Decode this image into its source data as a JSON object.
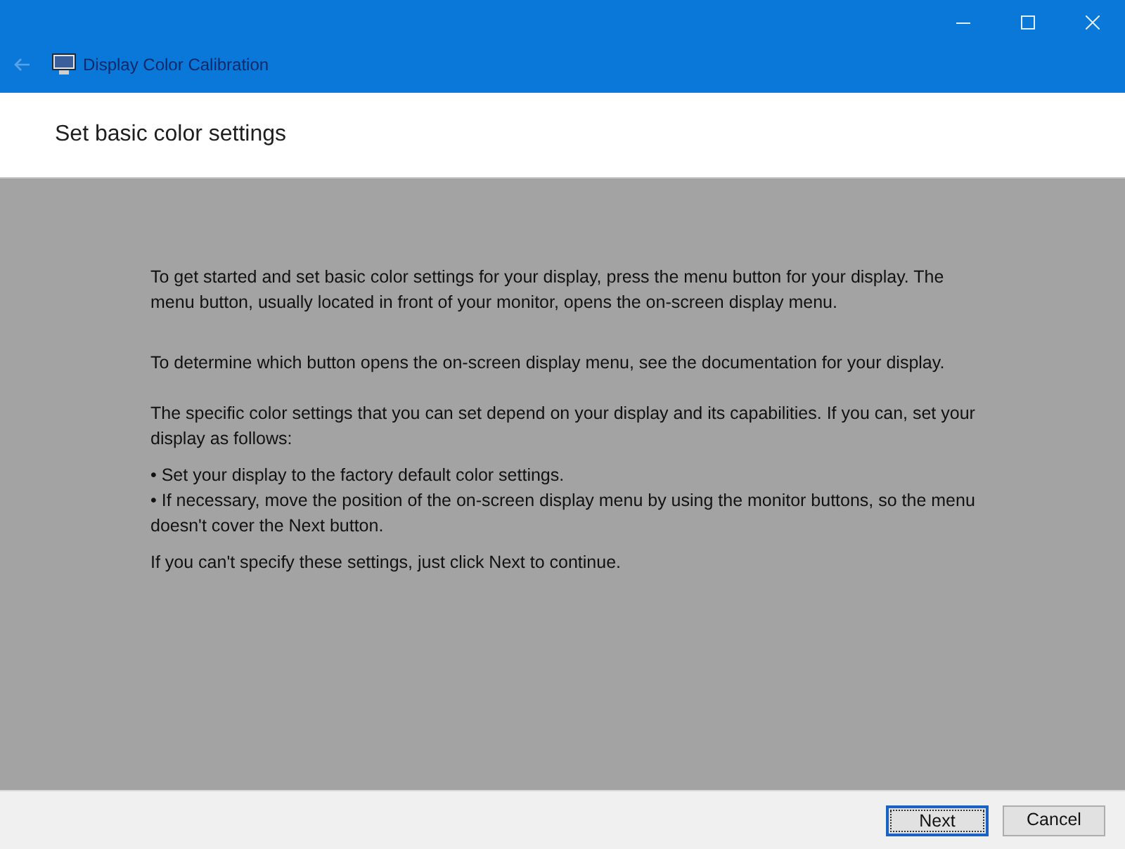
{
  "window": {
    "title": "Display Color Calibration"
  },
  "header": {
    "title": "Set basic color settings"
  },
  "body": {
    "paragraphs": [
      {
        "kind": "text",
        "text": "To get started and set basic color settings for your display, press the menu button for your display. The menu button, usually located in front of your monitor, opens the on-screen display menu."
      },
      {
        "kind": "text",
        "text": "To determine which button opens the on-screen display menu, see the documentation for your display."
      },
      {
        "kind": "text",
        "text": "The specific color settings that you can set depend on your display and its capabilities. If you can, set your display as follows:"
      },
      {
        "kind": "bullets",
        "items": [
          "• Set your display to the factory default color settings.",
          "• If necessary, move the position of the on-screen display menu by using the monitor buttons, so the menu doesn't cover the Next button."
        ]
      },
      {
        "kind": "text",
        "text": "If you can't specify these settings,  just click Next to continue."
      }
    ]
  },
  "buttons": [
    {
      "label": "Next",
      "default": true
    },
    {
      "label": "Cancel",
      "default": false
    }
  ]
}
